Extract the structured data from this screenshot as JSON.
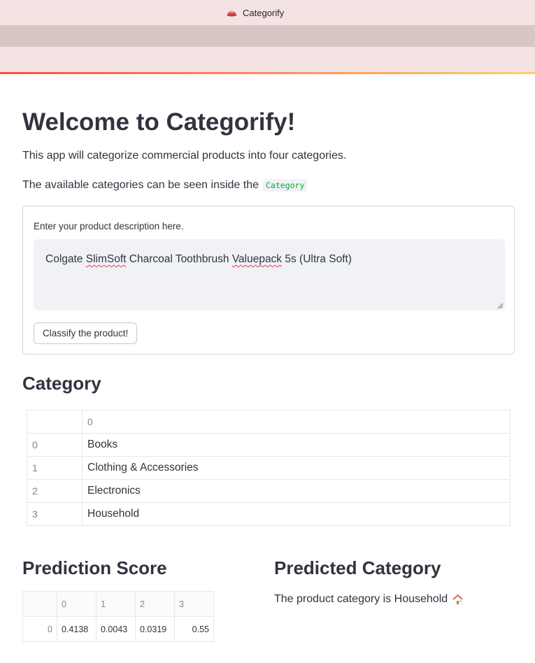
{
  "browser": {
    "tab_title": "Categorify",
    "tab_icon": "streamlit-logo-icon"
  },
  "header": {
    "title": "Welcome to Categorify!"
  },
  "intro": {
    "line1": "This app will categorize commercial products into four categories.",
    "line2": "The available categories can be seen inside the",
    "code_ref": "Category"
  },
  "form": {
    "label": "Enter your product description here.",
    "input_value_parts": [
      "Colgate ",
      "SlimSoft",
      " Charcoal Toothbrush ",
      "Valuepack",
      " 5s (Ultra Soft)"
    ],
    "submit_label": "Classify the product!"
  },
  "category_section": {
    "title": "Category",
    "column_header": "0",
    "rows": [
      {
        "index": "0",
        "value": "Books"
      },
      {
        "index": "1",
        "value": "Clothing & Accessories"
      },
      {
        "index": "2",
        "value": "Electronics"
      },
      {
        "index": "3",
        "value": "Household"
      }
    ]
  },
  "score_section": {
    "title": "Prediction Score",
    "columns": [
      "0",
      "1",
      "2",
      "3"
    ],
    "row_index": "0",
    "values": [
      "0.4138",
      "0.0043",
      "0.0319",
      "0.55"
    ]
  },
  "prediction": {
    "title": "Predicted Category",
    "text": "The product category is Household",
    "icon": "house-icon"
  },
  "colors": {
    "accent": "#ff4b4b",
    "code_text": "#09ab3b",
    "text": "#31333f",
    "input_bg": "#f0f2f6"
  }
}
